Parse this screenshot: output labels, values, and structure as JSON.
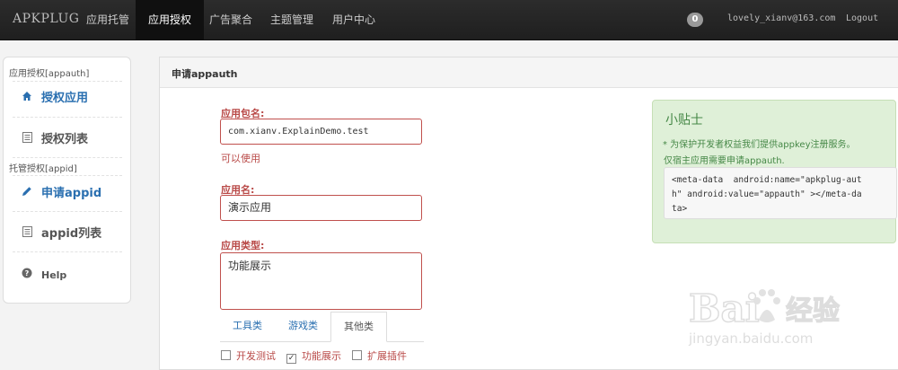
{
  "nav": {
    "brand": "APKPLUG",
    "items": [
      "应用托管",
      "应用授权",
      "广告聚合",
      "主题管理",
      "用户中心"
    ],
    "badge": "0",
    "email": "lovely_xianv@163.com",
    "logout": "Logout"
  },
  "sidebar": {
    "header1": "应用授权[appauth]",
    "item1": "授权应用",
    "item2": "授权列表",
    "header2": "托管授权[appid]",
    "item3": "申请appid",
    "item4": "appid列表",
    "item5": "Help"
  },
  "main": {
    "title": "申请appauth",
    "package_label": "应用包名:",
    "package_value": "com.xianv.ExplainDemo.test",
    "package_hint": "可以使用",
    "name_label": "应用名:",
    "name_value": "演示应用",
    "type_label": "应用类型:",
    "type_value": "功能展示",
    "tabs": [
      "工具类",
      "游戏类",
      "其他类"
    ],
    "checkboxes": [
      {
        "label": "开发测试",
        "checked": false
      },
      {
        "label": "功能展示",
        "checked": true
      },
      {
        "label": "扩展插件",
        "checked": false
      }
    ]
  },
  "tip": {
    "title": "小贴士",
    "line1": "* 为保护开发者权益我们提供appkey注册服务。",
    "line2": "仅宿主应用需要申请appauth.",
    "code": "<meta-data  android:name=\"apkplug-aut\nh\" android:value=\"appauth\" ></meta-da\nta>"
  },
  "watermark": {
    "brand": "Bai",
    "brand2": "经验",
    "url": "jingyan.baidu.com"
  },
  "colors": {
    "active_blue": "#2a6fb0",
    "error_red": "#b94a48",
    "tip_green": "#468847",
    "tip_bg": "#dff0d8"
  }
}
